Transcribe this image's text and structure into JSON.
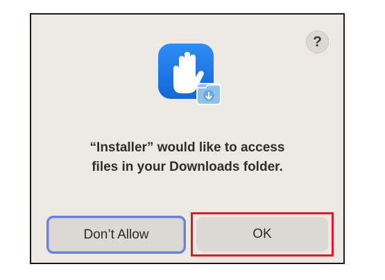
{
  "dialog": {
    "help_label": "?",
    "message_line1": "“Installer” would like to access",
    "message_line2": "files in your Downloads folder.",
    "icon": "privacy-hand-downloads-icon"
  },
  "buttons": {
    "dont_allow_label": "Don’t Allow",
    "ok_label": "OK"
  },
  "colors": {
    "dialog_background": "#ece8e2",
    "button_background": "#dcd8d2",
    "focus_ring": "#6f7fd6",
    "highlight_box": "#d4202c",
    "icon_blue": "#1f7ae8"
  }
}
